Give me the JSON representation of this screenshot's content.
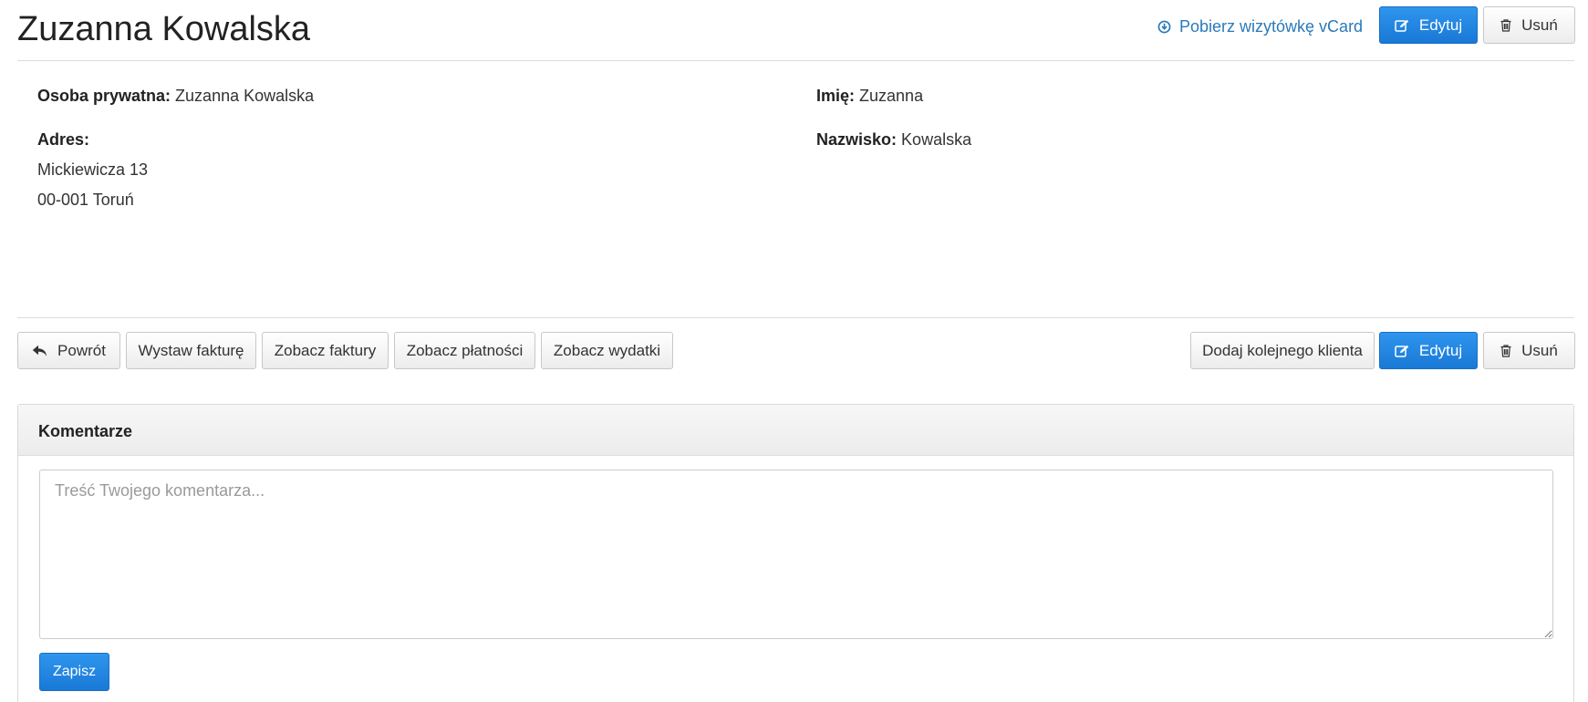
{
  "header": {
    "title": "Zuzanna Kowalska",
    "vcard_link": "Pobierz wizytówkę vCard",
    "edit_label": "Edytuj",
    "delete_label": "Usuń"
  },
  "details": {
    "private_person": {
      "label": "Osoba prywatna:",
      "value": "Zuzanna Kowalska"
    },
    "address": {
      "label": "Adres:",
      "line1": "Mickiewicza 13",
      "line2": "00-001 Toruń"
    },
    "first_name": {
      "label": "Imię:",
      "value": "Zuzanna"
    },
    "last_name": {
      "label": "Nazwisko:",
      "value": "Kowalska"
    }
  },
  "toolbar": {
    "back_label": "Powrót",
    "issue_invoice_label": "Wystaw fakturę",
    "view_invoices_label": "Zobacz faktury",
    "view_payments_label": "Zobacz płatności",
    "view_expenses_label": "Zobacz wydatki",
    "add_client_label": "Dodaj kolejnego klienta",
    "edit_label": "Edytuj",
    "delete_label": "Usuń"
  },
  "comments": {
    "heading": "Komentarze",
    "placeholder": "Treść Twojego komentarza...",
    "value": "",
    "save_label": "Zapisz"
  },
  "icons": {
    "download": "download-circle-icon",
    "edit": "edit-icon",
    "trash": "trash-icon",
    "back": "reply-arrow-icon"
  },
  "colors": {
    "primary": "#1979d6",
    "link": "#2a7ab9"
  }
}
